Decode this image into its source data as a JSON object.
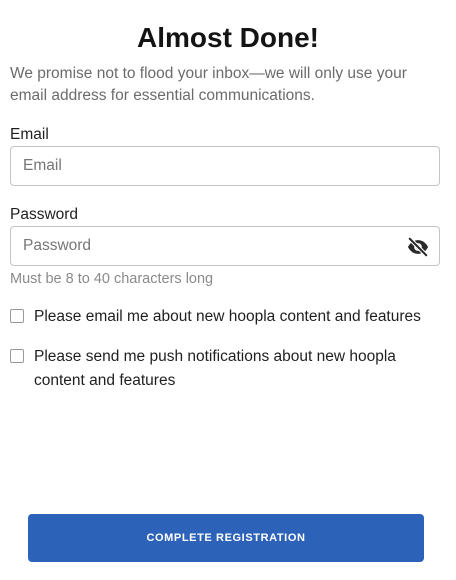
{
  "header": {
    "title": "Almost Done!",
    "subtitle": "We promise not to flood your inbox—we will only use your email address for essential communications."
  },
  "form": {
    "email": {
      "label": "Email",
      "placeholder": "Email",
      "value": ""
    },
    "password": {
      "label": "Password",
      "placeholder": "Password",
      "value": "",
      "hint": "Must be 8 to 40 characters long",
      "toggle_icon": "eye-slash-icon"
    },
    "opt_ins": [
      {
        "label": "Please email me about new hoopla content and features",
        "checked": false
      },
      {
        "label": "Please send me push notifications about new hoopla content and features",
        "checked": false
      }
    ],
    "submit_label": "COMPLETE REGISTRATION"
  },
  "colors": {
    "primary_button": "#2d62b9",
    "input_border": "#c4c4c4",
    "muted_text": "#6b6b6b"
  }
}
